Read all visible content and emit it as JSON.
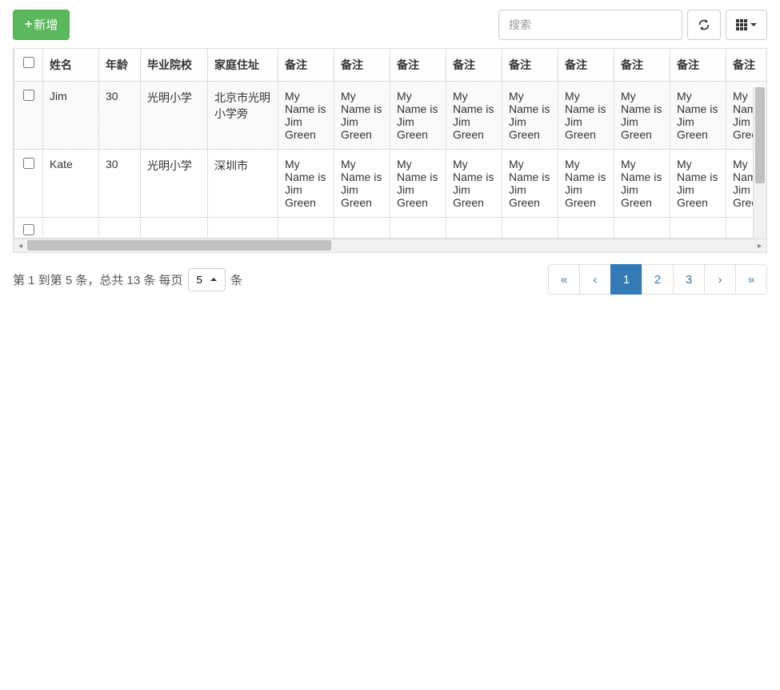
{
  "toolbar": {
    "add_label": "新增",
    "search_placeholder": "搜索"
  },
  "columns": {
    "name": "姓名",
    "age": "年龄",
    "school": "毕业院校",
    "address": "家庭住址",
    "remark": "备注"
  },
  "rows": [
    {
      "name": "Jim",
      "age": "30",
      "school": "光明小学",
      "address": "北京市光明小学旁",
      "remark": "My Name is Jim Green"
    },
    {
      "name": "Kate",
      "age": "30",
      "school": "光明小学",
      "address": "深圳市",
      "remark": "My Name is Jim Green"
    }
  ],
  "remark_repeat": 9,
  "pagination": {
    "info_prefix": "第 1 到第 5 条，总共 13 条 每页",
    "page_size": "5",
    "info_suffix": "条",
    "first": "«",
    "prev": "‹",
    "pages": [
      "1",
      "2",
      "3"
    ],
    "active_page": "1",
    "next": "›",
    "last": "»"
  }
}
